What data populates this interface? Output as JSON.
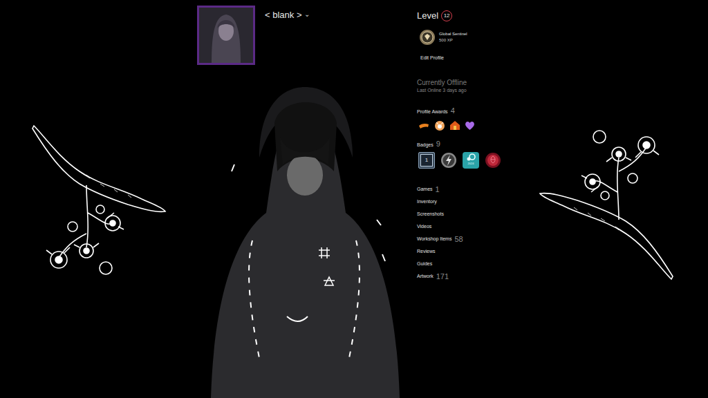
{
  "profile": {
    "name": "< blank >",
    "caret": "⌄",
    "online_status": "Currently Offline",
    "last_online": "Last Online 3 days ago"
  },
  "level": {
    "label": "Level",
    "value": "12"
  },
  "featured_badge": {
    "name": "Global Sentinel",
    "xp": "500 XP"
  },
  "edit_profile": "Edit Profile",
  "awards": {
    "label": "Profile Awards",
    "count": "4"
  },
  "badges": {
    "label": "Badges",
    "count": "9",
    "years_badge": "1",
    "steam_badge_year": "2024"
  },
  "links": [
    {
      "label": "Games",
      "count": "1"
    },
    {
      "label": "Inventory"
    },
    {
      "label": "Screenshots"
    },
    {
      "label": "Videos"
    },
    {
      "label": "Workshop Items",
      "count": "58"
    },
    {
      "label": "Reviews"
    },
    {
      "label": "Guides"
    },
    {
      "label": "Artwork",
      "count": "171"
    }
  ]
}
